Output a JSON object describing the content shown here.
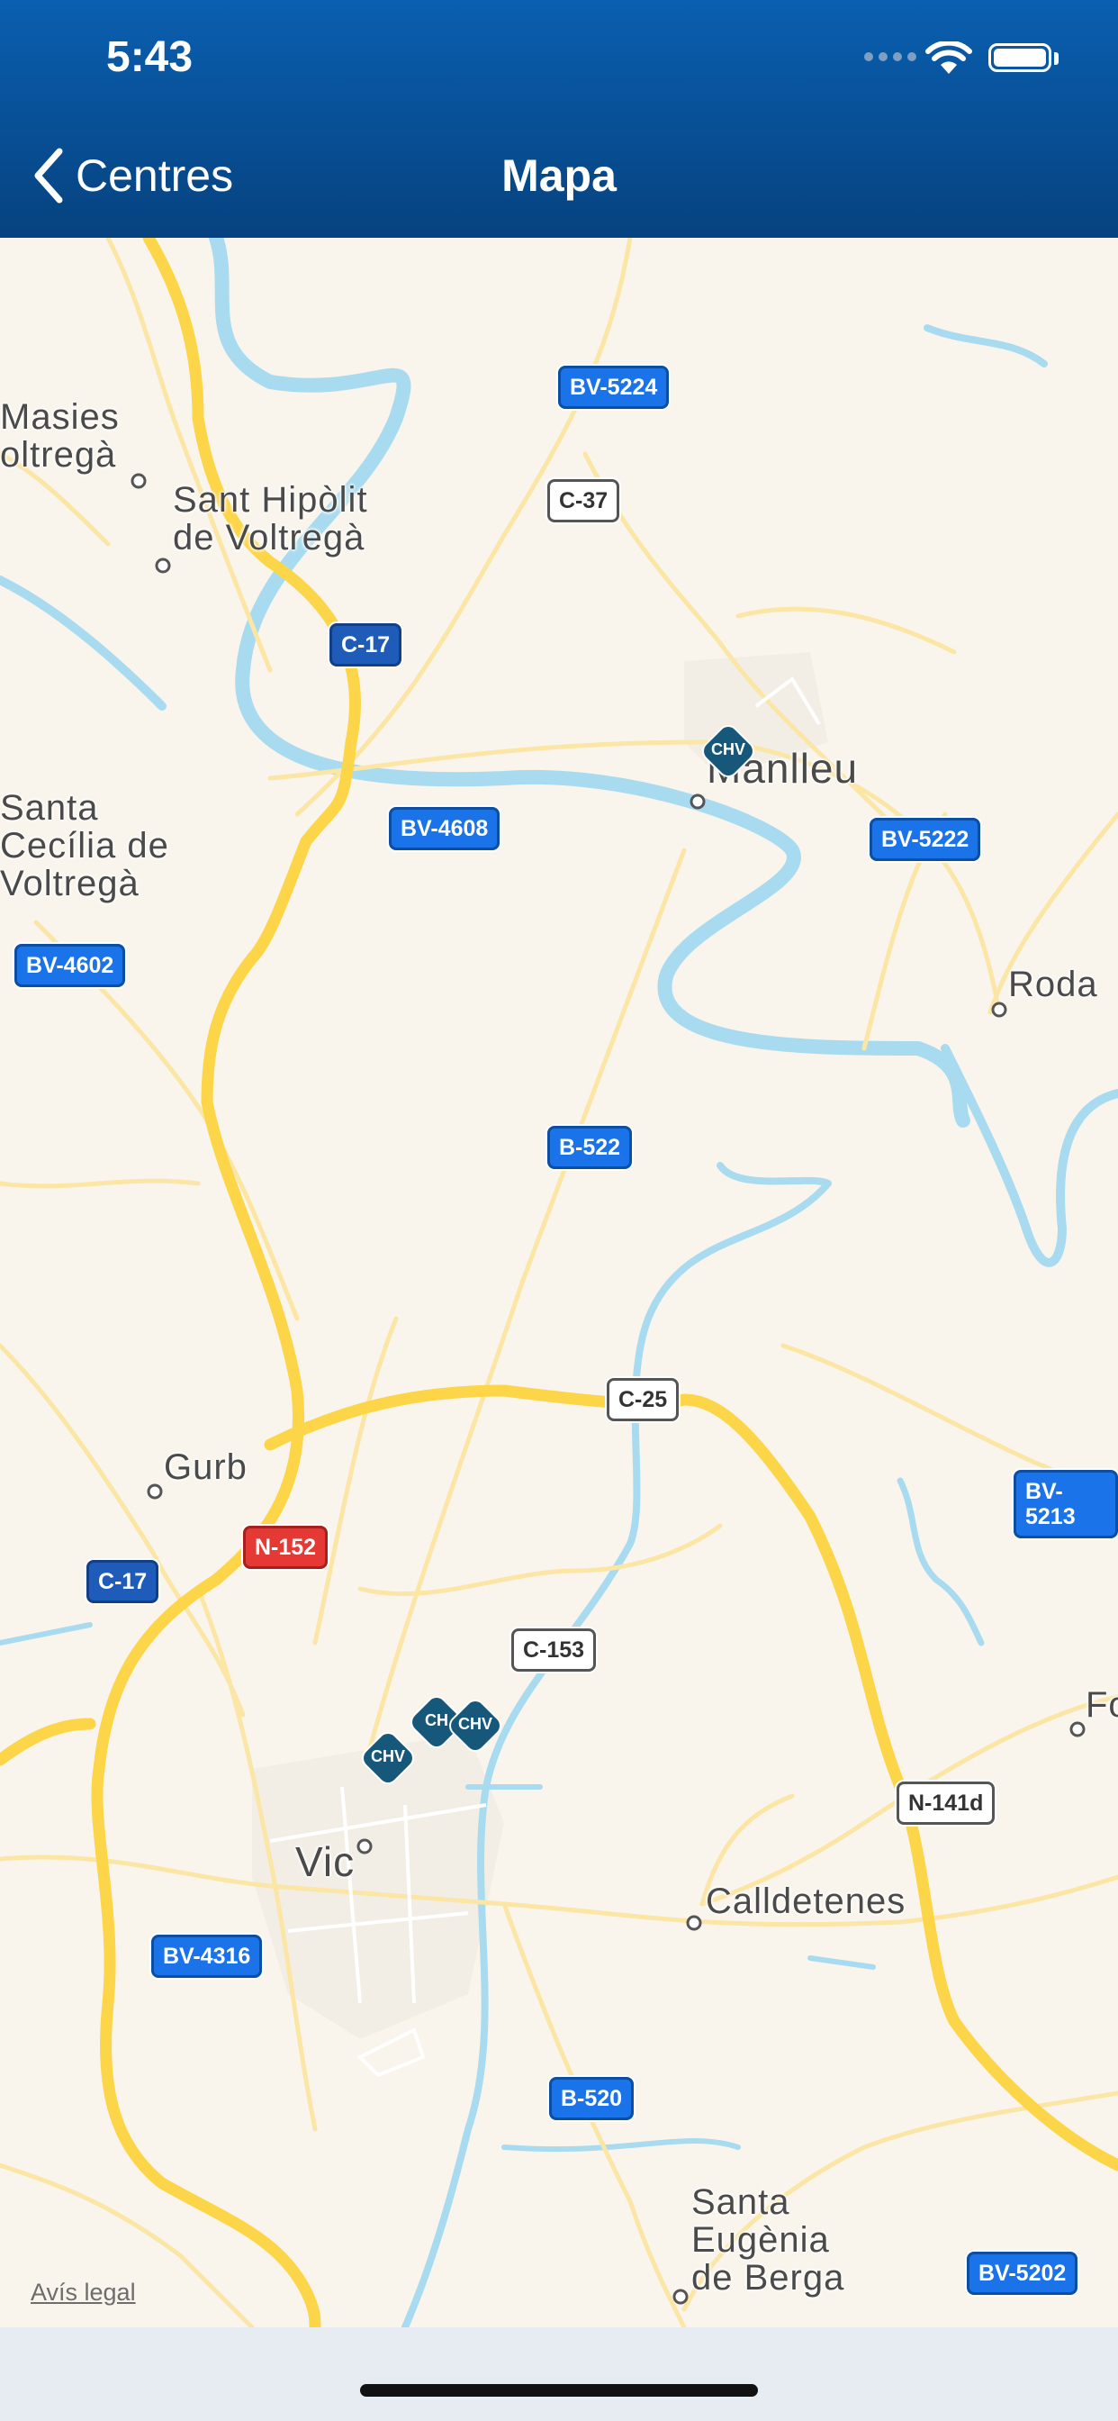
{
  "status_bar": {
    "time": "5:43"
  },
  "nav": {
    "back_label": "Centres",
    "title": "Mapa"
  },
  "map": {
    "places": {
      "masies": "Masies\noltregà",
      "sant_hipolit": "Sant Hipòlit\nde Voltregà",
      "manlleu": "Manlleu",
      "santa_cecilia": "Santa\nCecília de\nVoltregà",
      "roda": "Roda",
      "gurb": "Gurb",
      "vic": "Vic",
      "calldetenes": "Calldetenes",
      "santa_eugenia": "Santa\nEugènia\nde Berga",
      "fo": "Fo"
    },
    "roads": {
      "bv5224": "BV-5224",
      "c37": "C-37",
      "c17_top": "C-17",
      "bv4608": "BV-4608",
      "bv5222": "BV-5222",
      "bv4602": "BV-4602",
      "b522": "B-522",
      "c25": "C-25",
      "bv5213": "BV-5213",
      "n152": "N-152",
      "c17_bottom": "C-17",
      "c153": "C-153",
      "n141d": "N-141d",
      "bv4316": "BV-4316",
      "b520": "B-520",
      "bv5202": "BV-5202"
    },
    "markers": {
      "manlleu": "CHV",
      "vic_left": "CHV",
      "vic_mid": "CH",
      "vic_right": "CHV"
    },
    "legal_link": "Avís legal",
    "colors": {
      "land": "#f9f5ec",
      "water": "#a9dbf0",
      "highway": "#fdd549",
      "road": "#fbe6a6",
      "urban": "#ffffff",
      "marker": "#17587a"
    }
  }
}
